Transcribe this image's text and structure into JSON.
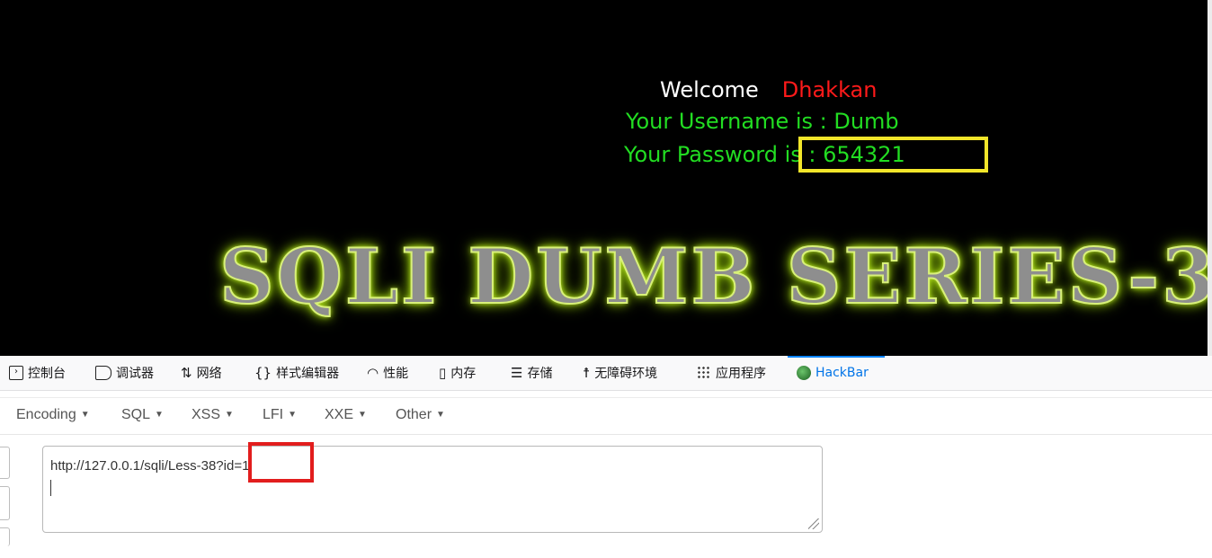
{
  "page": {
    "welcome_label": "Welcome",
    "welcome_name": "Dhakkan",
    "username_line": "Your Username is : Dumb",
    "password_prefix": "Your Password",
    "password_value": "is : 654321",
    "banner_text": "SQLI DUMB SERIES-3"
  },
  "devtools": {
    "tabs": [
      {
        "label": "控制台",
        "icon": "console-icon"
      },
      {
        "label": "调试器",
        "icon": "debugger-icon"
      },
      {
        "label": "网络",
        "icon": "network-icon"
      },
      {
        "label": "样式编辑器",
        "icon": "style-editor-icon"
      },
      {
        "label": "性能",
        "icon": "performance-icon"
      },
      {
        "label": "内存",
        "icon": "memory-icon"
      },
      {
        "label": "存储",
        "icon": "storage-icon"
      },
      {
        "label": "无障碍环境",
        "icon": "accessibility-icon"
      },
      {
        "label": "应用程序",
        "icon": "application-icon"
      },
      {
        "label": "HackBar",
        "icon": "hackbar-icon"
      }
    ],
    "active_tab": "HackBar"
  },
  "hackbar": {
    "menus": [
      "Encoding",
      "SQL",
      "XSS",
      "LFI",
      "XXE",
      "Other"
    ],
    "url_base": "http://127.0.0.1/sqli/Less-38",
    "url_query": "?id=1"
  },
  "colors": {
    "viewport_bg": "#000000",
    "green_text": "#22dd22",
    "name_red": "#ff1a1a",
    "highlight_yellow": "#f2e62a",
    "highlight_red": "#e21d1d",
    "active_tab_blue": "#0074e8"
  }
}
